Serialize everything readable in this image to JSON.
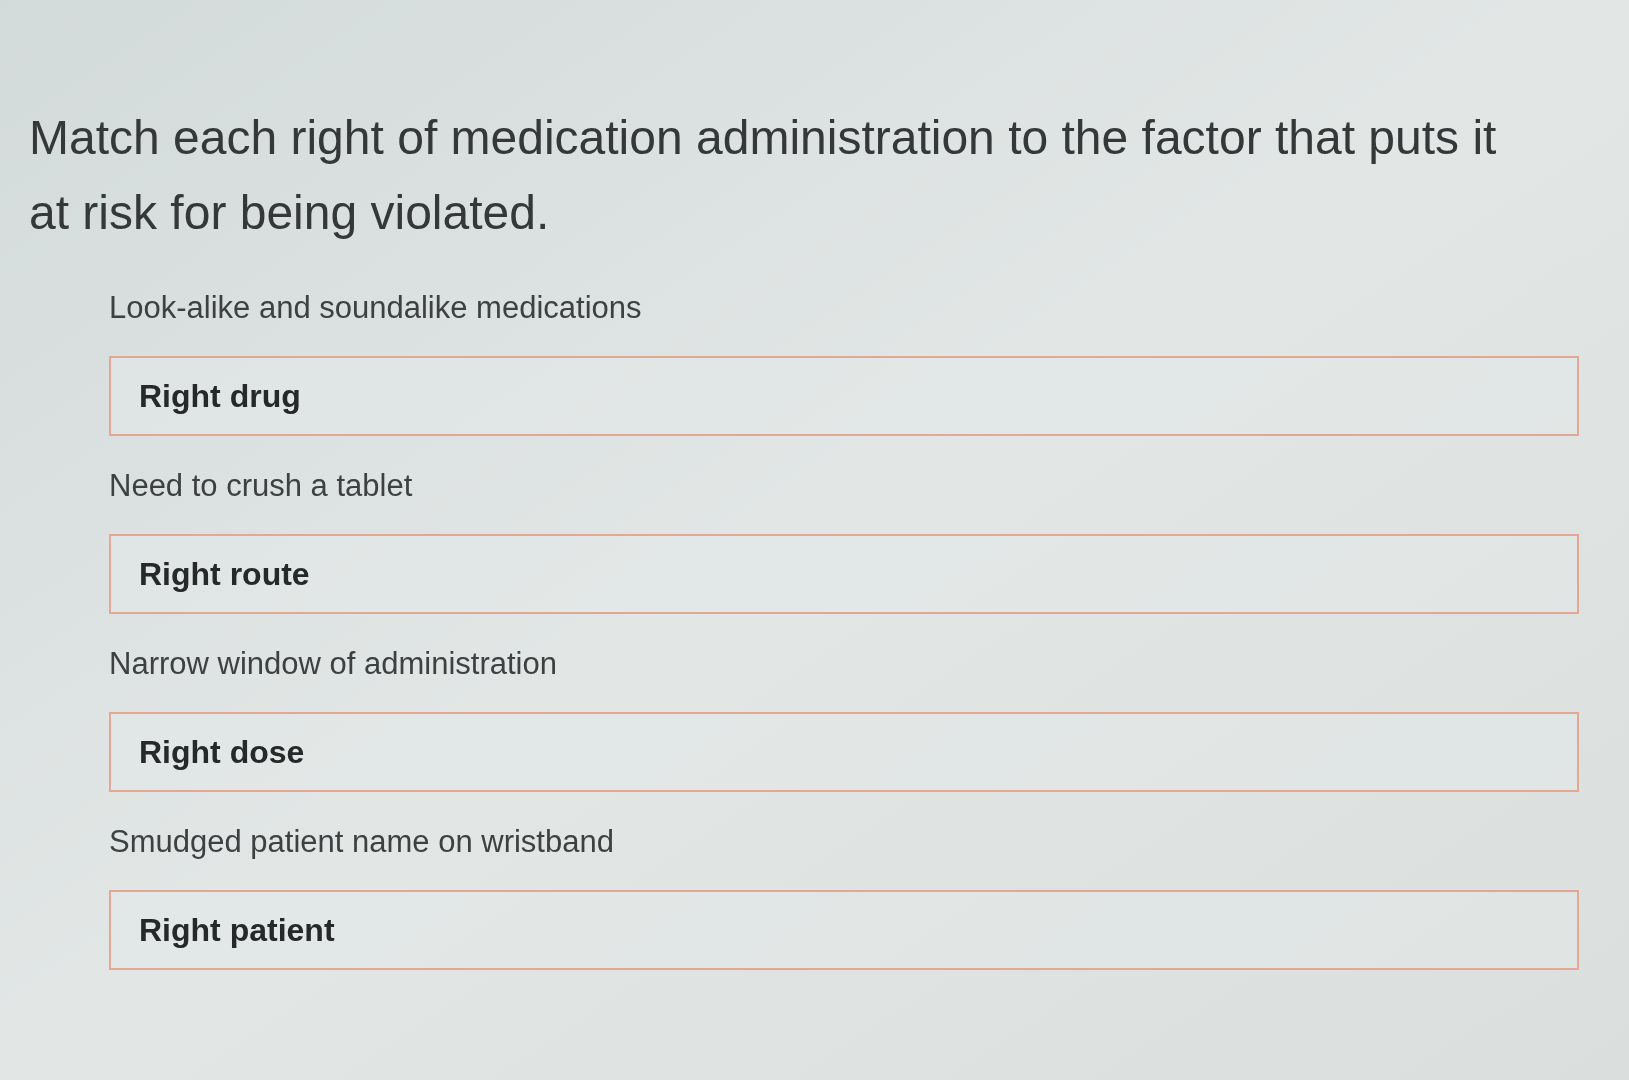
{
  "question": "Match each right of medication administration to the factor that puts it at risk for being violated.",
  "pairs": [
    {
      "prompt": "Look-alike and soundalike medications",
      "answer": "Right drug"
    },
    {
      "prompt": "Need to crush a tablet",
      "answer": "Right route"
    },
    {
      "prompt": "Narrow window of administration",
      "answer": "Right dose"
    },
    {
      "prompt": "Smudged patient name on wristband",
      "answer": "Right patient"
    }
  ]
}
